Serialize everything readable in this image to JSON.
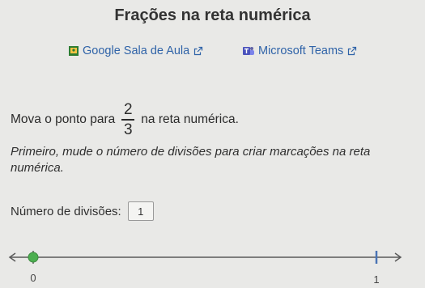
{
  "header": {
    "title": "Frações na reta numérica"
  },
  "share": {
    "classroom": {
      "label": "Google Sala de Aula",
      "icon": "google-classroom-icon"
    },
    "teams": {
      "label": "Microsoft Teams",
      "icon": "microsoft-teams-icon"
    },
    "external_icon": "external-link-icon"
  },
  "question": {
    "prompt_before": "Mova o ponto para",
    "fraction": {
      "numerator": "2",
      "denominator": "3"
    },
    "prompt_after": "na reta numérica.",
    "instruction": "Primeiro, mude o número de divisões para criar marcações na reta numérica."
  },
  "divisions": {
    "label": "Número de divisões:",
    "value": "1"
  },
  "number_line": {
    "start_label": "0",
    "end_label": "1",
    "point_value": 0,
    "point_color": "#4caf50"
  },
  "colors": {
    "link": "#2f63a8",
    "accent": "#4caf50",
    "axis": "#5a5a5a"
  }
}
